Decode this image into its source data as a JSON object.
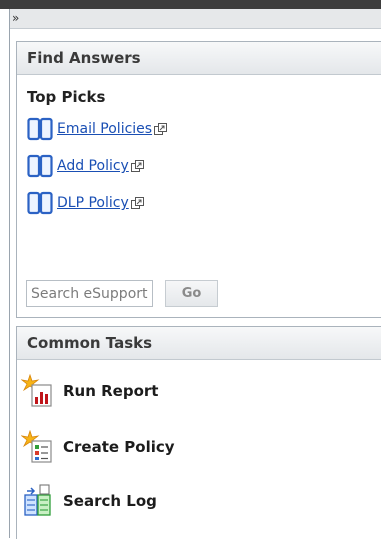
{
  "collapse": {
    "glyph": "»"
  },
  "find_answers": {
    "title": "Find Answers",
    "top_picks_label": "Top Picks",
    "links": [
      {
        "label": "Email Policies",
        "icon": "book-icon"
      },
      {
        "label": "Add Policy",
        "icon": "book-icon"
      },
      {
        "label": "DLP Policy",
        "icon": "book-icon"
      }
    ],
    "search": {
      "placeholder": "Search eSupport",
      "value": ""
    },
    "go_label": "Go"
  },
  "common_tasks": {
    "title": "Common Tasks",
    "items": [
      {
        "label": "Run Report",
        "icon": "report-icon"
      },
      {
        "label": "Create Policy",
        "icon": "create-policy-icon"
      },
      {
        "label": "Search Log",
        "icon": "search-log-icon"
      }
    ]
  },
  "colors": {
    "link": "#1a4fb4",
    "book": "#2b62c4",
    "report_red": "#c0161b",
    "star_orange": "#f39a12"
  }
}
